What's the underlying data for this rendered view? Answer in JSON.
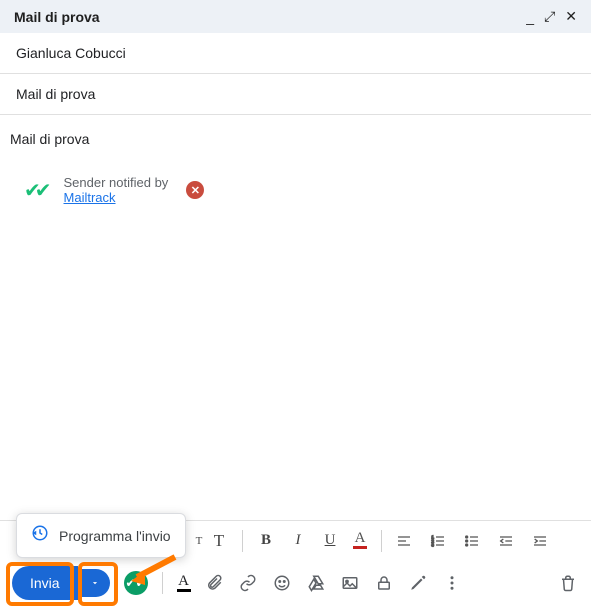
{
  "header": {
    "title": "Mail di prova"
  },
  "recipient": "Gianluca Cobucci",
  "subject": "Mail di prova",
  "body_text": "Mail di prova",
  "tracker": {
    "notified_by": "Sender notified by",
    "brand": "Mailtrack"
  },
  "schedule_menu": {
    "label": "Programma l'invio"
  },
  "actions": {
    "send_label": "Invia"
  },
  "format": {
    "size_small": "T",
    "size_large": "T",
    "bold": "B",
    "italic": "I",
    "underline": "U",
    "textA": "A"
  }
}
